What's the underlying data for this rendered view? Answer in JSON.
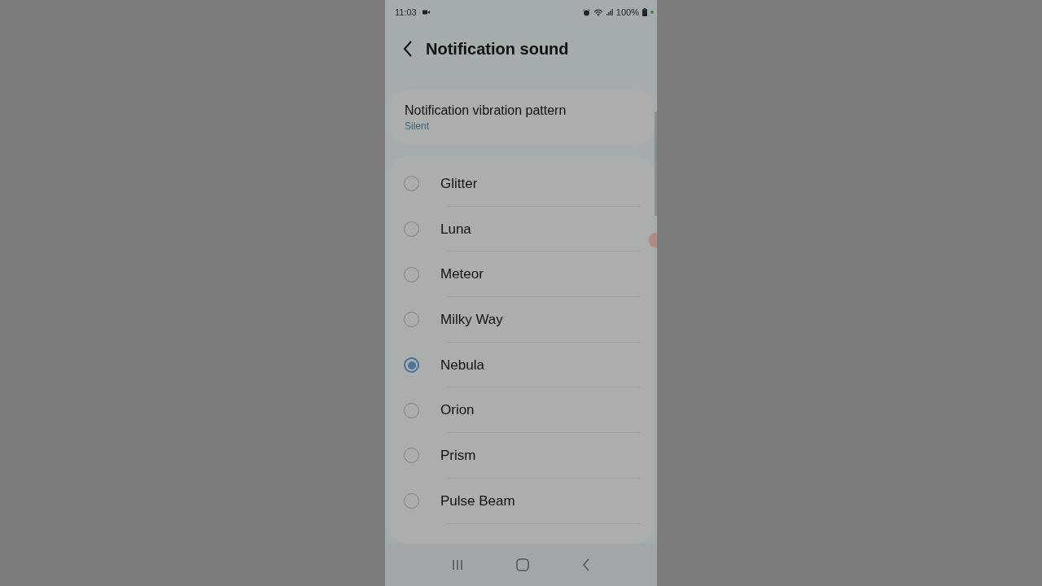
{
  "status_bar": {
    "time": "11:03",
    "battery": "100%"
  },
  "header": {
    "title": "Notification sound"
  },
  "vibration": {
    "label": "Notification vibration pattern",
    "value": "Silent"
  },
  "sounds": [
    {
      "label": "Glitter",
      "selected": false
    },
    {
      "label": "Luna",
      "selected": false
    },
    {
      "label": "Meteor",
      "selected": false
    },
    {
      "label": "Milky Way",
      "selected": false
    },
    {
      "label": "Nebula",
      "selected": true
    },
    {
      "label": "Orion",
      "selected": false
    },
    {
      "label": "Prism",
      "selected": false
    },
    {
      "label": "Pulse Beam",
      "selected": false
    }
  ]
}
